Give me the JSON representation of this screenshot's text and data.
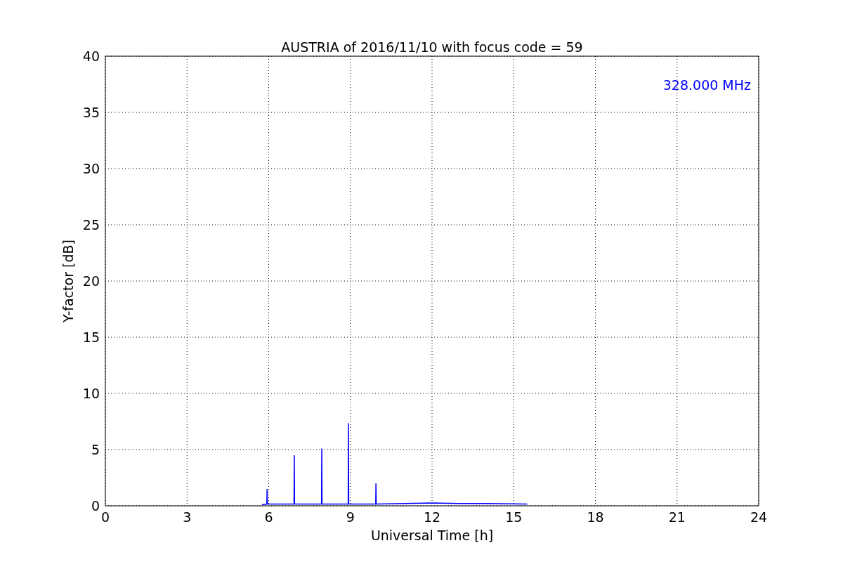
{
  "chart_data": {
    "type": "line",
    "title": "AUSTRIA of 2016/11/10 with focus code = 59",
    "xlabel": "Universal Time [h]",
    "ylabel": "Y-factor [dB]",
    "x": [
      5.75,
      5.93,
      5.94,
      5.95,
      6.93,
      6.94,
      6.95,
      7.94,
      7.95,
      7.96,
      8.92,
      8.93,
      8.94,
      9.93,
      9.94,
      9.95,
      11,
      12,
      13,
      14,
      15.5
    ],
    "series": [
      {
        "name": "328.000 MHz",
        "color": "#0000ff",
        "values": [
          0.1,
          0.15,
          1.5,
          0.15,
          0.15,
          4.5,
          0.15,
          0.15,
          5.1,
          0.15,
          0.15,
          7.35,
          0.15,
          0.15,
          2.0,
          0.15,
          0.2,
          0.25,
          0.2,
          0.2,
          0.15
        ]
      }
    ],
    "xlim": [
      0,
      24
    ],
    "ylim": [
      0,
      40
    ],
    "xticks": [
      0,
      3,
      6,
      9,
      12,
      15,
      18,
      21,
      24
    ],
    "yticks": [
      0,
      5,
      10,
      15,
      20,
      25,
      30,
      35,
      40
    ],
    "grid": true
  }
}
